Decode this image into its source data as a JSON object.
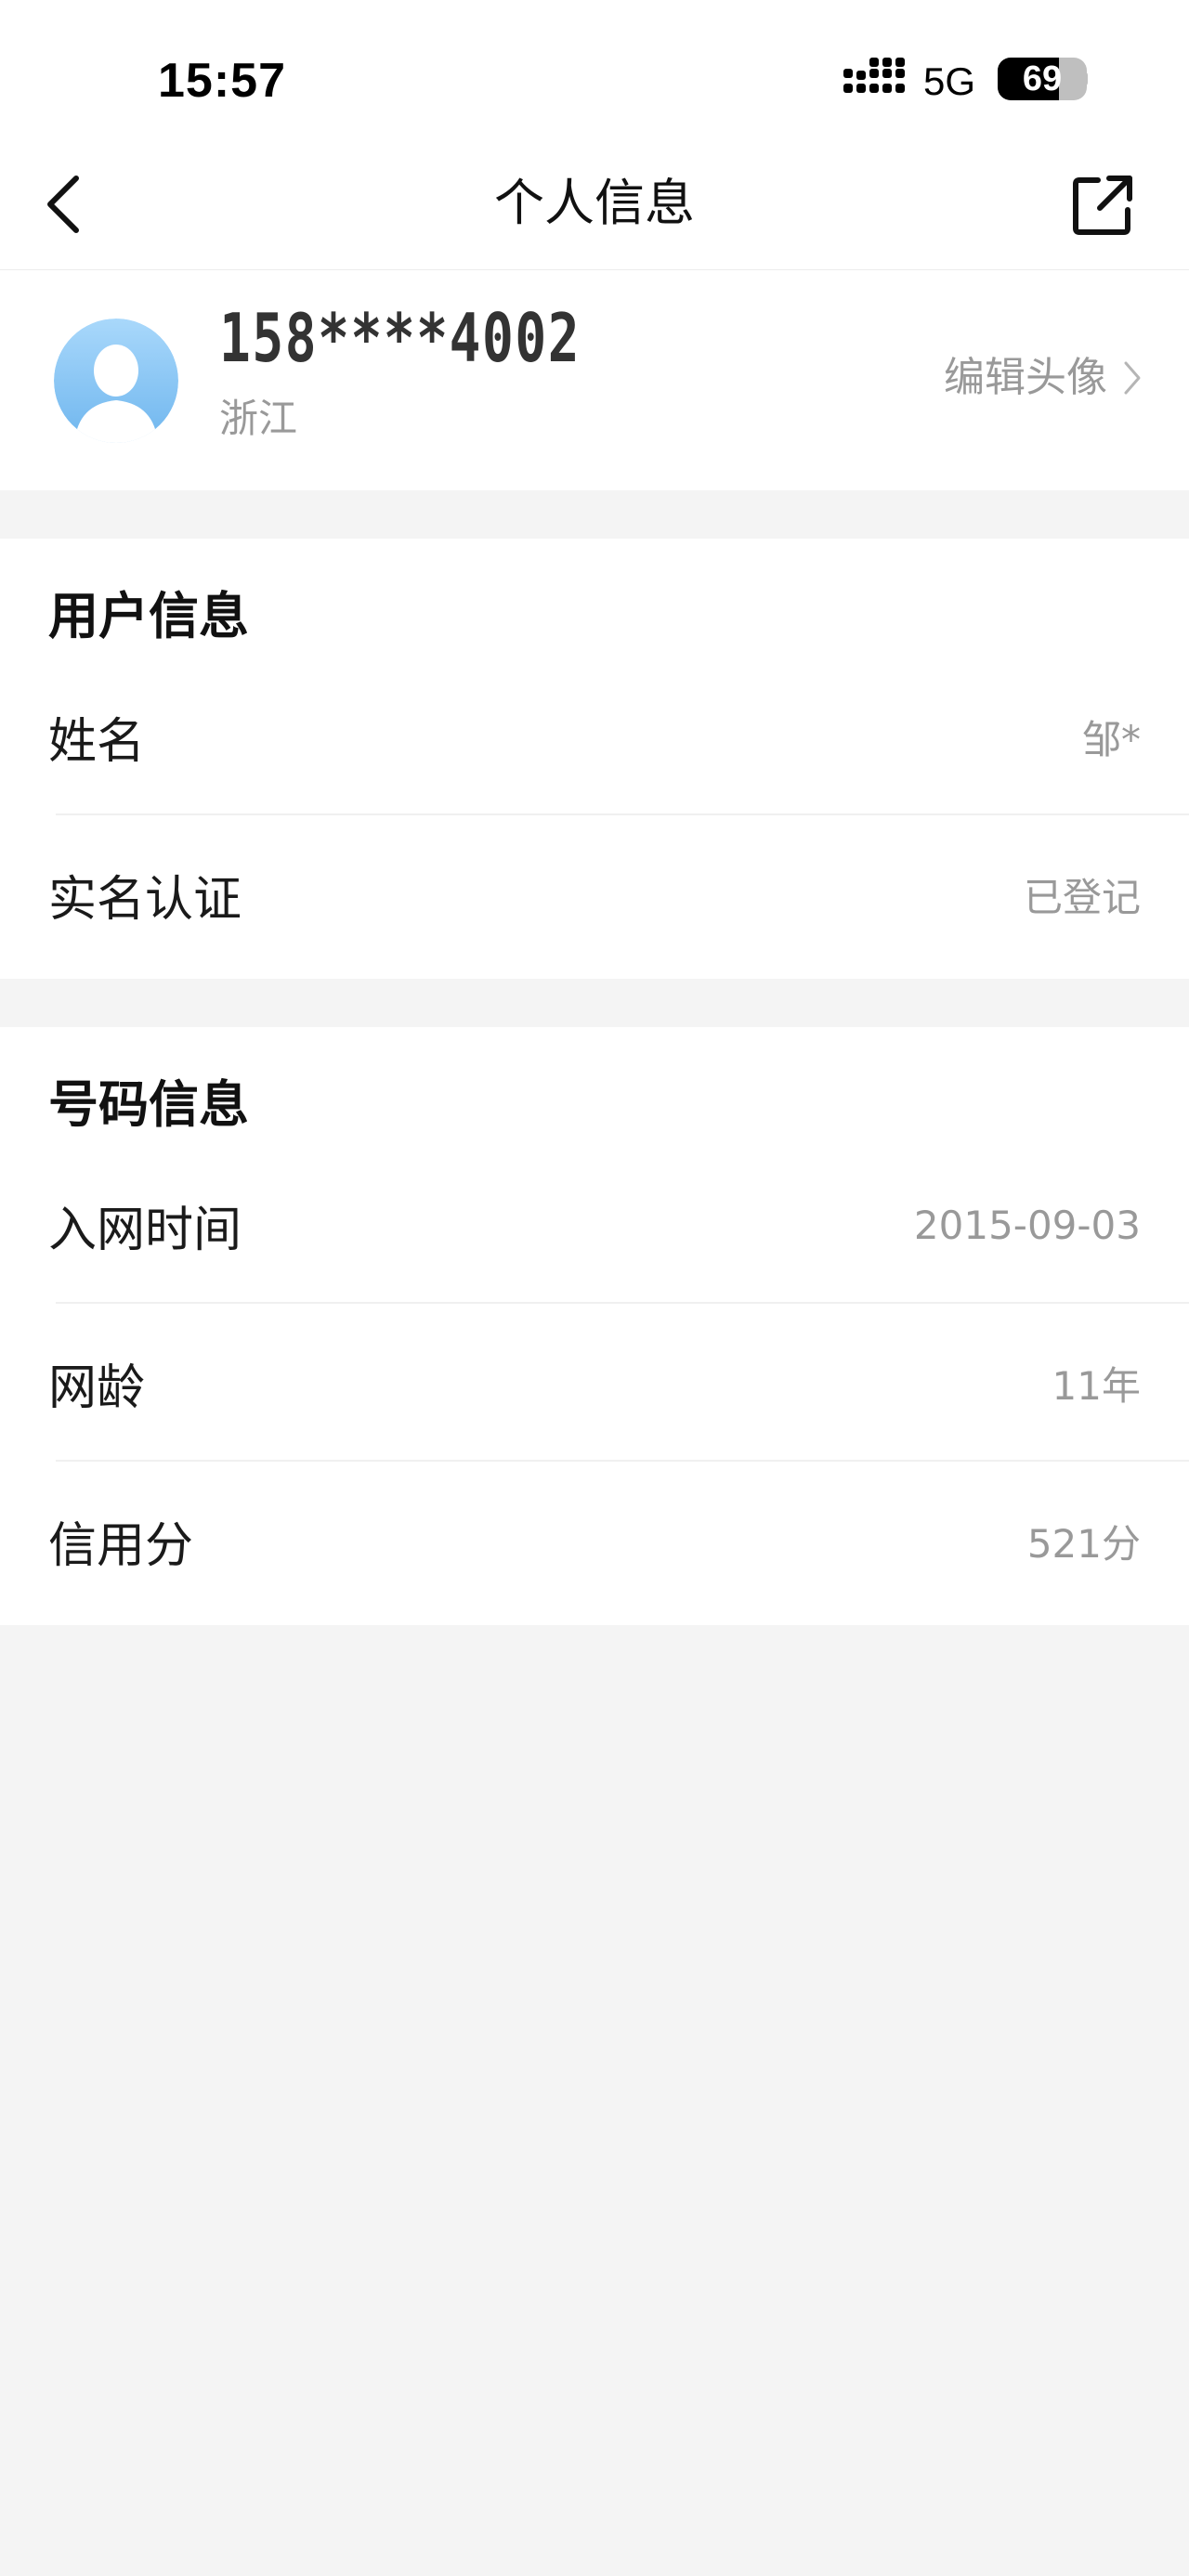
{
  "status_bar": {
    "time": "15:57",
    "network": "5G",
    "battery_level": "69",
    "battery_fraction": 0.69
  },
  "header": {
    "title": "个人信息",
    "back_icon": "chevron-left-icon",
    "share_icon": "share-external-icon"
  },
  "profile": {
    "phone": "158****4002",
    "region": "浙江",
    "edit_avatar_label": "编辑头像",
    "avatar_color": "#8cc8f4"
  },
  "user_info": {
    "title": "用户信息",
    "rows": [
      {
        "label": "姓名",
        "value": "邹*"
      },
      {
        "label": "实名认证",
        "value": "已登记"
      }
    ]
  },
  "number_info": {
    "title": "号码信息",
    "rows": [
      {
        "label": "入网时间",
        "value": "2015-09-03"
      },
      {
        "label": "网龄",
        "value": "11年"
      },
      {
        "label": "信用分",
        "value": "521分"
      }
    ]
  },
  "colors": {
    "background": "#f4f4f4",
    "card": "#ffffff",
    "secondary_text": "#999999",
    "primary_text": "#1a1a1a"
  }
}
